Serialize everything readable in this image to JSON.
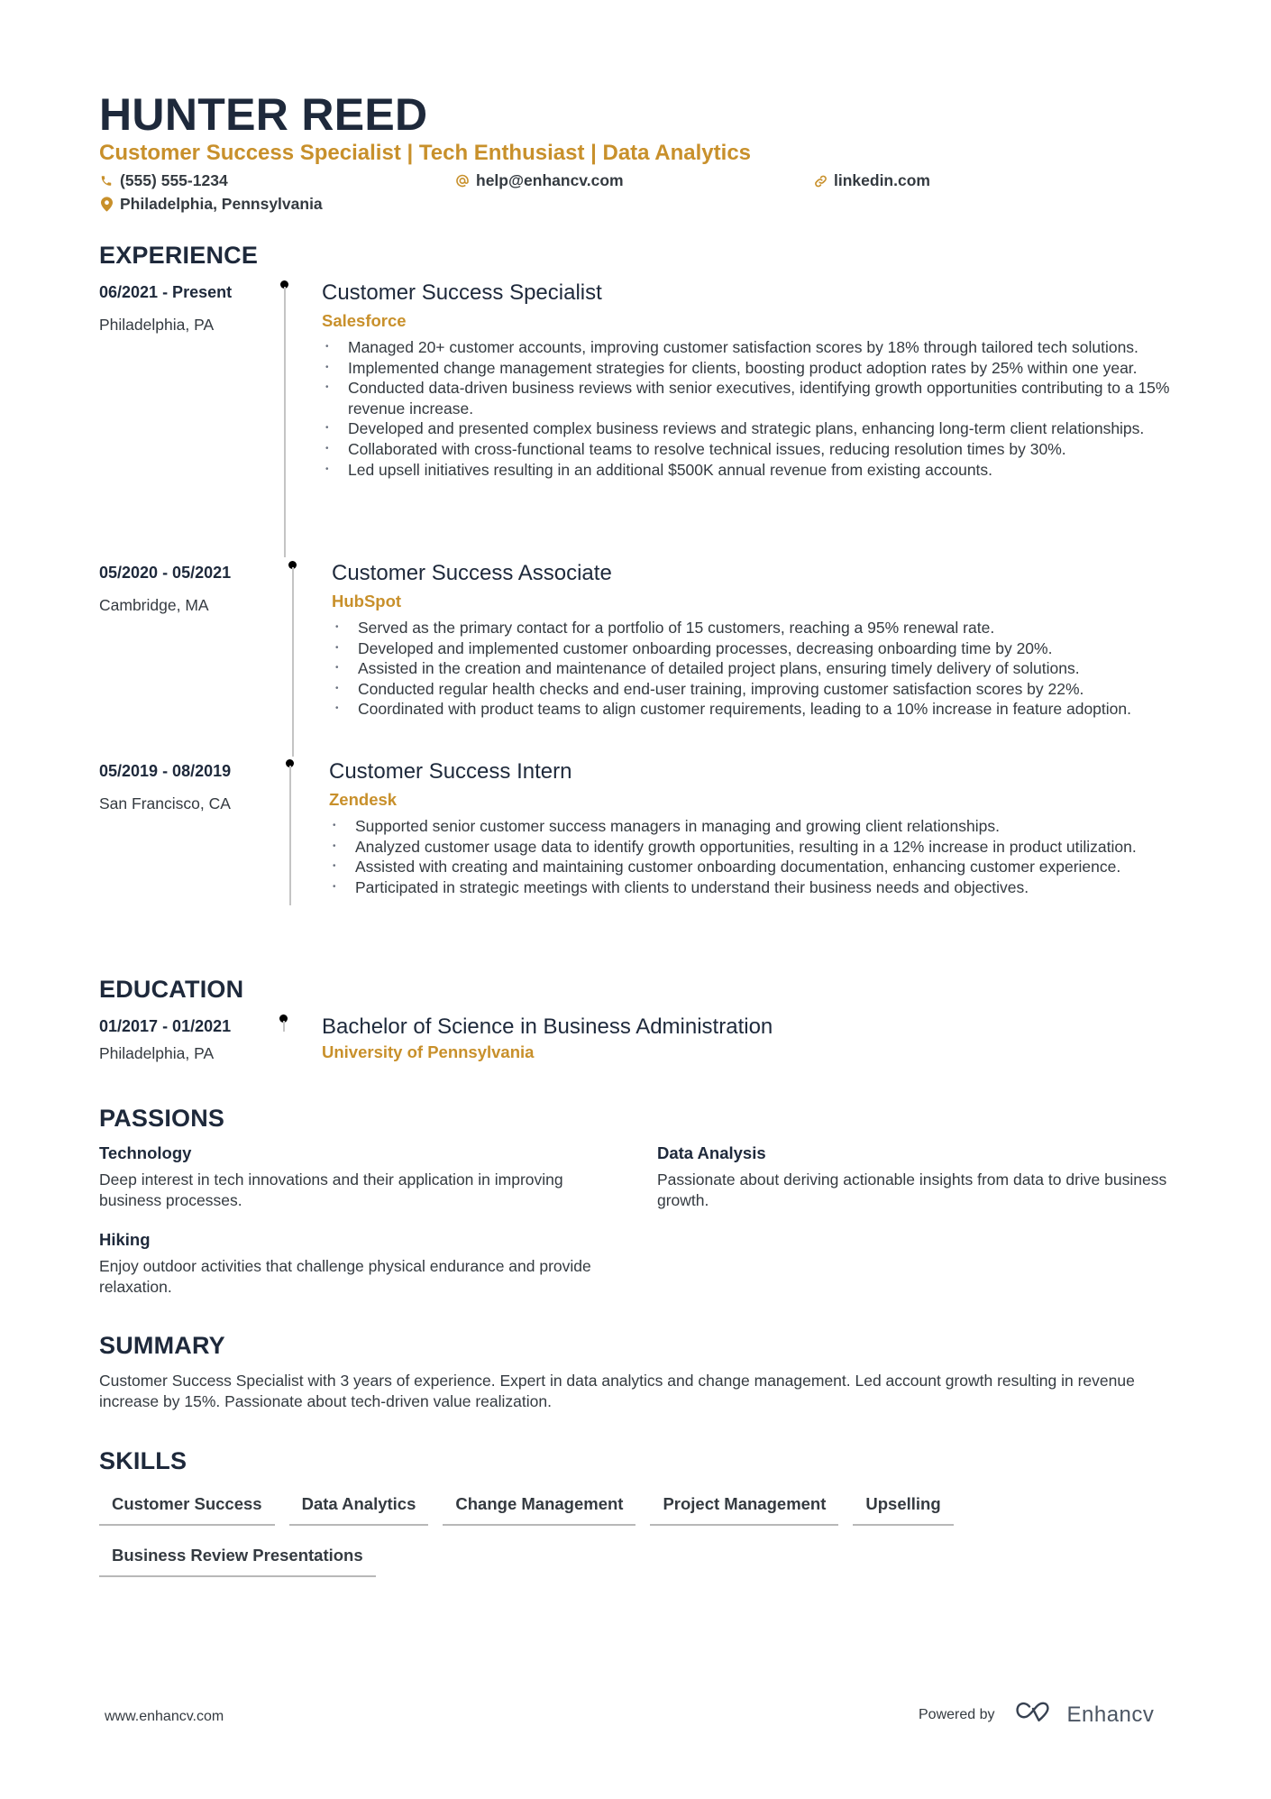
{
  "header": {
    "name": "HUNTER REED",
    "headline": "Customer Success Specialist | Tech Enthusiast | Data Analytics",
    "contacts": {
      "phone": {
        "icon": "phone-icon",
        "value": "(555) 555-1234"
      },
      "email": {
        "icon": "at-icon",
        "value": "help@enhancv.com"
      },
      "linkedin": {
        "icon": "link-icon",
        "value": "linkedin.com"
      },
      "location": {
        "icon": "location-pin-icon",
        "value": "Philadelphia, Pennsylvania"
      }
    }
  },
  "colors": {
    "accent": "#c8902b",
    "heading": "#1e293b",
    "body": "#343a40",
    "timeline_line": "#c4c4c4"
  },
  "experience": {
    "title": "EXPERIENCE",
    "entries": [
      {
        "date": "06/2021 - Present",
        "location": "Philadelphia, PA",
        "role": "Customer Success Specialist",
        "company": "Salesforce",
        "bullets": [
          "Managed 20+ customer accounts, improving customer satisfaction scores by 18% through tailored tech solutions.",
          "Implemented change management strategies for clients, boosting product adoption rates by 25% within one year.",
          "Conducted data-driven business reviews with senior executives, identifying growth opportunities contributing to a 15% revenue increase.",
          "Developed and presented complex business reviews and strategic plans, enhancing long-term client relationships.",
          "Collaborated with cross-functional teams to resolve technical issues, reducing resolution times by 30%.",
          "Led upsell initiatives resulting in an additional $500K annual revenue from existing accounts."
        ]
      },
      {
        "date": "05/2020 - 05/2021",
        "location": "Cambridge, MA",
        "role": "Customer Success Associate",
        "company": "HubSpot",
        "bullets": [
          "Served as the primary contact for a portfolio of 15 customers, reaching a 95% renewal rate.",
          "Developed and implemented customer onboarding processes, decreasing onboarding time by 20%.",
          "Assisted in the creation and maintenance of detailed project plans, ensuring timely delivery of solutions.",
          "Conducted regular health checks and end-user training, improving customer satisfaction scores by 22%.",
          "Coordinated with product teams to align customer requirements, leading to a 10% increase in feature adoption."
        ]
      },
      {
        "date": "05/2019 - 08/2019",
        "location": "San Francisco, CA",
        "role": "Customer Success Intern",
        "company": "Zendesk",
        "bullets": [
          "Supported senior customer success managers in managing and growing client relationships.",
          "Analyzed customer usage data to identify growth opportunities, resulting in a 12% increase in product utilization.",
          "Assisted with creating and maintaining customer onboarding documentation, enhancing customer experience.",
          "Participated in strategic meetings with clients to understand their business needs and objectives."
        ]
      }
    ]
  },
  "education": {
    "title": "EDUCATION",
    "entries": [
      {
        "date": "01/2017 - 01/2021",
        "location": "Philadelphia, PA",
        "degree": "Bachelor of Science in Business Administration",
        "school": "University of Pennsylvania"
      }
    ]
  },
  "passions": {
    "title": "PASSIONS",
    "items": [
      {
        "title": "Technology",
        "description": "Deep interest in tech innovations and their application in improving business processes."
      },
      {
        "title": "Data Analysis",
        "description": "Passionate about deriving actionable insights from data to drive business growth."
      },
      {
        "title": "Hiking",
        "description": "Enjoy outdoor activities that challenge physical endurance and provide relaxation."
      }
    ]
  },
  "summary": {
    "title": "SUMMARY",
    "text": "Customer Success Specialist with 3 years of experience. Expert in data analytics and change management. Led account growth resulting in revenue increase by 15%. Passionate about tech-driven value realization."
  },
  "skills": {
    "title": "SKILLS",
    "items": [
      "Customer Success",
      "Data Analytics",
      "Change Management",
      "Project Management",
      "Upselling",
      "Business Review Presentations"
    ]
  },
  "footer": {
    "website": "www.enhancv.com",
    "powered_by": "Powered by",
    "brand": "Enhancv",
    "brand_icon": "enhancv-logo-icon"
  }
}
